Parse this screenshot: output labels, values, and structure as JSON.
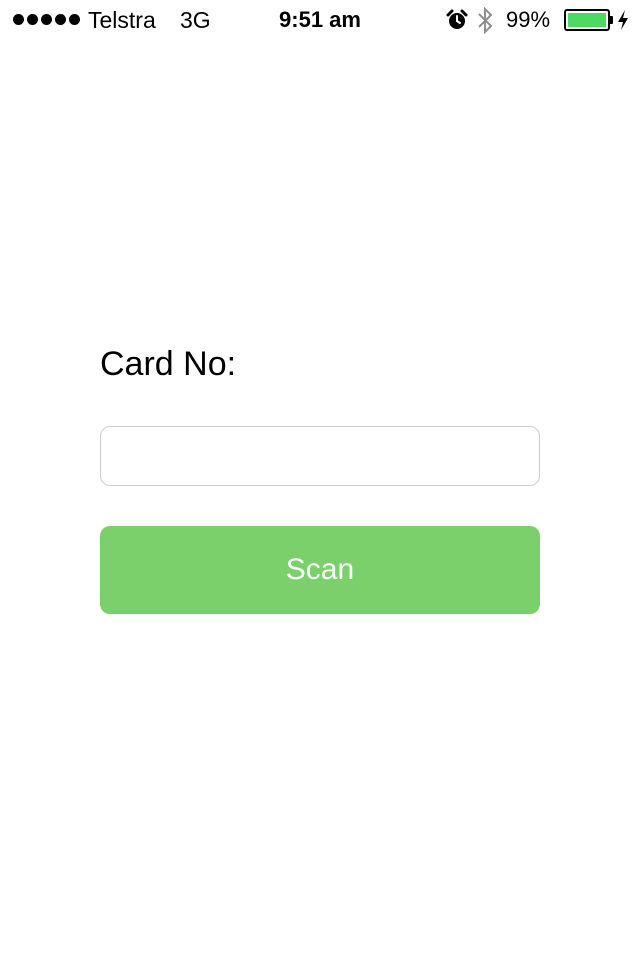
{
  "status_bar": {
    "signal_dots": 5,
    "carrier": "Telstra",
    "network": "3G",
    "time": "9:51 am",
    "alarm_icon": "alarm-clock-icon",
    "bluetooth_icon": "bluetooth-icon",
    "battery_percent_text": "99%",
    "battery_level": 0.99,
    "battery_color": "#4cd964",
    "charging_icon": "lightning-bolt-icon"
  },
  "form": {
    "label": "Card No:",
    "input_value": "",
    "input_placeholder": "",
    "scan_label": "Scan",
    "scan_color": "#7bd06c"
  }
}
